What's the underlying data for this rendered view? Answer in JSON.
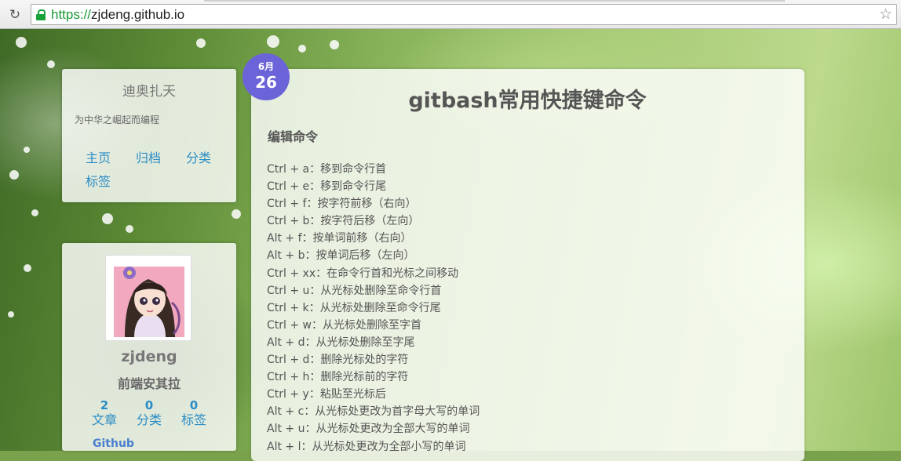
{
  "browser": {
    "reload_icon": "reload-icon",
    "url_scheme": "https://",
    "url_host": "zjdeng.github.io",
    "bookmark_icon": "star-icon"
  },
  "site": {
    "title": "迪奥扎天",
    "subtitle": "为中华之崛起而编程",
    "nav": [
      "主页",
      "归档",
      "分类",
      "标签"
    ]
  },
  "author": {
    "name": "zjdeng",
    "description": "前端安其拉",
    "stats": [
      {
        "value": "2",
        "label": "文章"
      },
      {
        "value": "0",
        "label": "分类"
      },
      {
        "value": "0",
        "label": "标签"
      }
    ],
    "github_label": "Github"
  },
  "post": {
    "month": "6月",
    "day": "26",
    "title": "gitbash常用快捷键命令",
    "section_heading": "编辑命令",
    "commands": [
      "Ctrl + a：移到命令行首",
      "Ctrl + e：移到命令行尾",
      "Ctrl + f：按字符前移（右向）",
      "Ctrl + b：按字符后移（左向）",
      "Alt + f：按单词前移（右向）",
      "Alt + b：按单词后移（左向）",
      "Ctrl + xx：在命令行首和光标之间移动",
      "Ctrl + u：从光标处删除至命令行首",
      "Ctrl + k：从光标处删除至命令行尾",
      "Ctrl + w：从光标处删除至字首",
      "Alt + d：从光标处删除至字尾",
      "Ctrl + d：删除光标处的字符",
      "Ctrl + h：删除光标前的字符",
      "Ctrl + y：粘贴至光标后",
      "Alt + c：从光标处更改为首字母大写的单词",
      "Alt + u：从光标处更改为全部大写的单词",
      "Alt + l：从光标处更改为全部小写的单词"
    ]
  },
  "colors": {
    "link": "#2a8cc4",
    "date_badge": "#6b63d8",
    "secure_green": "#1a9b35"
  }
}
